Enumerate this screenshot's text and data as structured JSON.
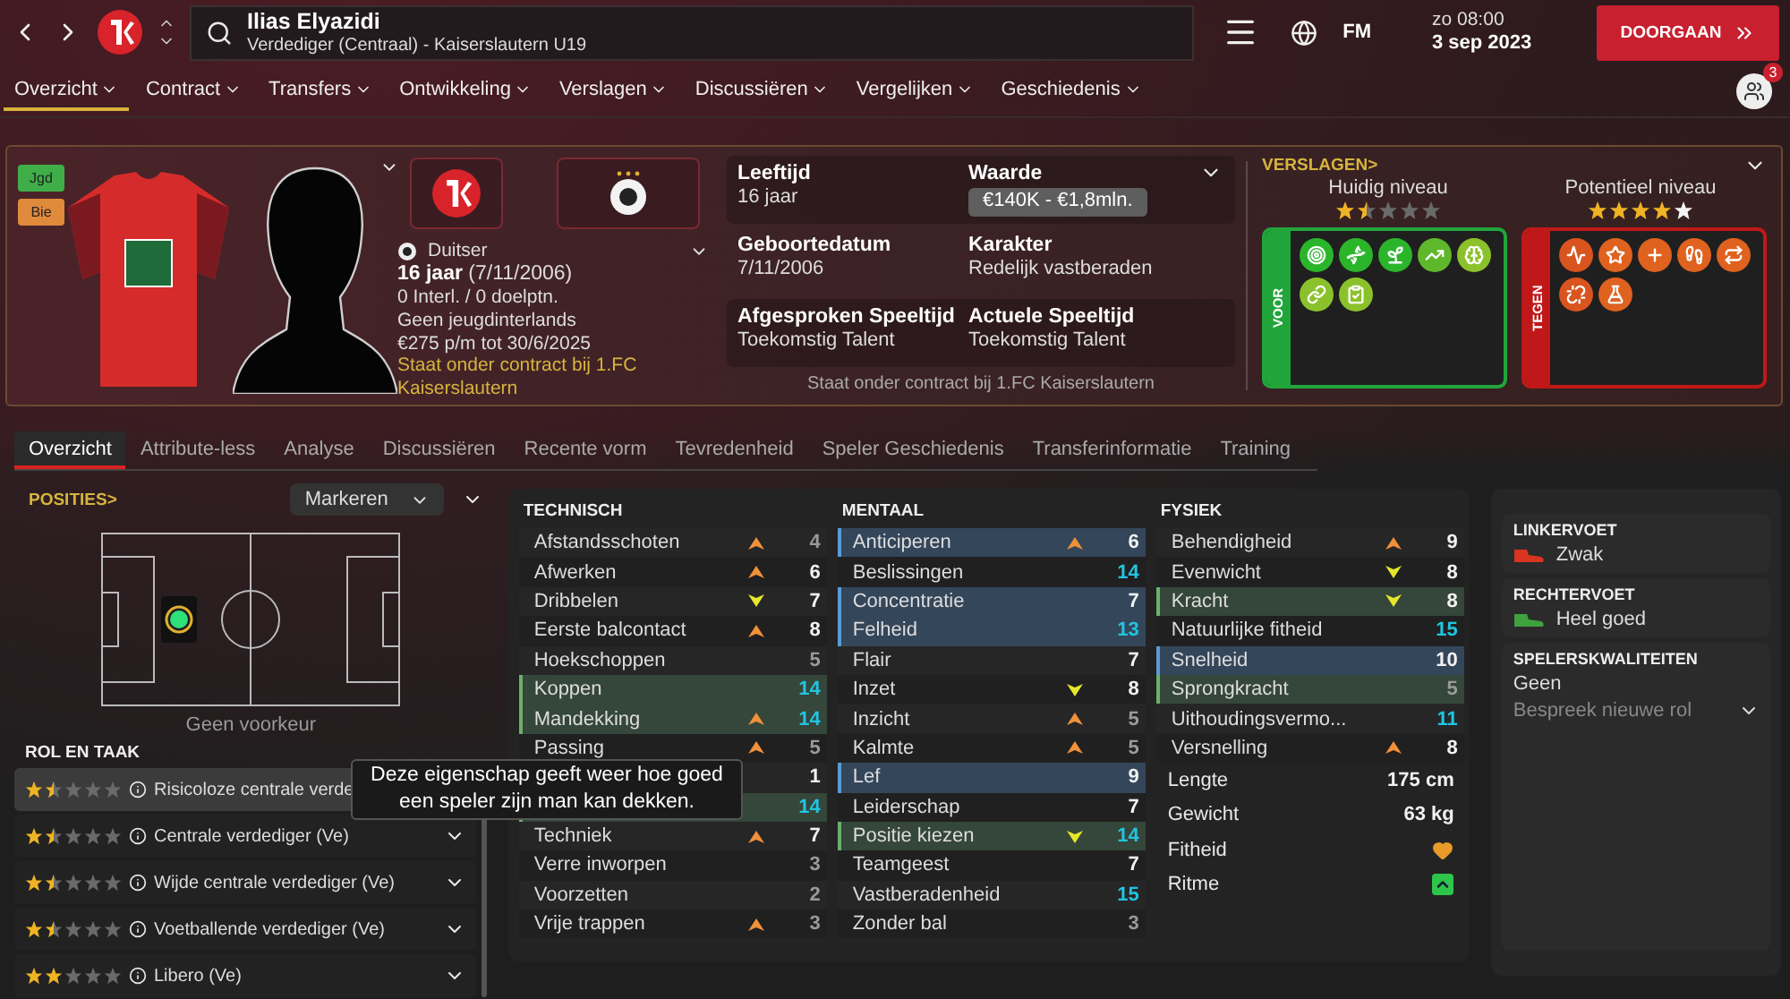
{
  "topbar": {
    "title": "Ilias Elyazidi",
    "subtitle": "Verdediger (Centraal) - Kaiserslautern U19",
    "logo_text": "FM",
    "day_time": "zo 08:00",
    "date": "3 sep 2023",
    "continue_button": "DOORGAAN"
  },
  "nav": {
    "items": [
      {
        "label": "Overzicht",
        "selected": true
      },
      {
        "label": "Contract",
        "selected": false
      },
      {
        "label": "Transfers",
        "selected": false
      },
      {
        "label": "Ontwikkeling",
        "selected": false
      },
      {
        "label": "Verslagen",
        "selected": false
      },
      {
        "label": "Discussiëren",
        "selected": false
      },
      {
        "label": "Vergelijken",
        "selected": false
      },
      {
        "label": "Geschiedenis",
        "selected": false
      }
    ],
    "badge": "3"
  },
  "profile": {
    "tags": [
      {
        "label": "Jgd",
        "color": "#3fae49"
      },
      {
        "label": "Bie",
        "color": "#e08a3c"
      }
    ],
    "nationality": "Duitser",
    "age_line": "**16 jaar** (7/11/2006)",
    "caps": "0 Interl. / 0 doelptn.",
    "youth_caps": "Geen jeugdinterlands",
    "wage": "€275 p/m tot 30/6/2025",
    "contract_status": "Staat onder contract bij 1.FC Kaiserslautern"
  },
  "facts": {
    "items": [
      {
        "label": "Leeftijd",
        "value": "16 jaar",
        "kind": "text"
      },
      {
        "label": "Waarde",
        "value": "€140K - €1,8mln.",
        "kind": "pill"
      },
      {
        "label": "Geboortedatum",
        "value": "7/11/2006",
        "kind": "text"
      },
      {
        "label": "Karakter",
        "value": "Redelijk vastberaden",
        "kind": "text"
      },
      {
        "label": "Afgesproken Speeltijd",
        "value": "Toekomstig Talent",
        "kind": "text"
      },
      {
        "label": "Actuele Speeltijd",
        "value": "Toekomstig Talent",
        "kind": "text"
      }
    ],
    "footer": "Staat onder contract bij 1.FC Kaiserslautern"
  },
  "reports": {
    "link": "VERSLAGEN>",
    "levels": [
      {
        "label": "Huidig niveau",
        "stars": 1.5,
        "range": false
      },
      {
        "label": "Potentieel niveau",
        "stars": 4,
        "range": true
      }
    ],
    "pro_label": "VOOR",
    "pros": [
      {
        "kind": "target"
      },
      {
        "kind": "dna"
      },
      {
        "kind": "sprout"
      },
      {
        "kind": "trend"
      },
      {
        "kind": "brain"
      },
      {
        "kind": "link"
      },
      {
        "kind": "clipboard"
      }
    ],
    "con_label": "TEGEN",
    "cons": [
      {
        "kind": "pulse"
      },
      {
        "kind": "star"
      },
      {
        "kind": "plus"
      },
      {
        "kind": "foot"
      },
      {
        "kind": "repeat"
      },
      {
        "kind": "unlink"
      },
      {
        "kind": "flask"
      }
    ]
  },
  "tabs": [
    {
      "label": "Overzicht",
      "selected": true
    },
    {
      "label": "Attribute-less",
      "selected": false
    },
    {
      "label": "Analyse",
      "selected": false
    },
    {
      "label": "Discussiëren",
      "selected": false
    },
    {
      "label": "Recente vorm",
      "selected": false
    },
    {
      "label": "Tevredenheid",
      "selected": false
    },
    {
      "label": "Speler Geschiedenis",
      "selected": false
    },
    {
      "label": "Transferinformatie",
      "selected": false
    },
    {
      "label": "Training",
      "selected": false
    }
  ],
  "positions": {
    "link": "POSITIES>",
    "view": "Markeren",
    "preference": "Geen voorkeur"
  },
  "roles": {
    "title": "ROL EN TAAK",
    "items": [
      {
        "name": "Risicoloze centrale verde",
        "stars": 1.5,
        "selected": true
      },
      {
        "name": "Centrale verdediger (Ve)",
        "stars": 1.5,
        "selected": false
      },
      {
        "name": "Wijde centrale verdediger (Ve)",
        "stars": 1.5,
        "selected": false
      },
      {
        "name": "Voetballende verdediger (Ve)",
        "stars": 1.5,
        "selected": false
      },
      {
        "name": "Libero (Ve)",
        "stars": 2,
        "selected": false
      }
    ]
  },
  "attributes": {
    "groups": [
      {
        "title": "TECHNISCH",
        "rows": [
          {
            "name": "Afstandsschoten",
            "value": "4",
            "rising": true,
            "falling": false,
            "strong": false,
            "weak": true,
            "key": false,
            "preferred": false
          },
          {
            "name": "Afwerken",
            "value": "6",
            "rising": true,
            "falling": false,
            "strong": false,
            "weak": false,
            "key": false,
            "preferred": false
          },
          {
            "name": "Dribbelen",
            "value": "7",
            "rising": false,
            "falling": true,
            "strong": false,
            "weak": false,
            "key": false,
            "preferred": false
          },
          {
            "name": "Eerste balcontact",
            "value": "8",
            "rising": true,
            "falling": false,
            "strong": false,
            "weak": false,
            "key": false,
            "preferred": false
          },
          {
            "name": "Hoekschoppen",
            "value": "5",
            "rising": false,
            "falling": false,
            "strong": false,
            "weak": true,
            "key": false,
            "preferred": false
          },
          {
            "name": "Koppen",
            "value": "14",
            "rising": false,
            "falling": false,
            "strong": true,
            "weak": false,
            "key": false,
            "preferred": true
          },
          {
            "name": "Mandekking",
            "value": "14",
            "rising": true,
            "falling": false,
            "strong": true,
            "weak": false,
            "key": false,
            "preferred": true
          },
          {
            "name": "Passing",
            "value": "5",
            "rising": true,
            "falling": false,
            "strong": false,
            "weak": true,
            "key": false,
            "preferred": false
          },
          {
            "value": "1",
            "rising": false,
            "falling": false,
            "strong": false,
            "weak": false,
            "key": false,
            "preferred": false
          },
          {
            "value": "14",
            "rising": false,
            "falling": false,
            "strong": true,
            "weak": false,
            "key": false,
            "preferred": true
          },
          {
            "name": "Techniek",
            "value": "7",
            "rising": true,
            "falling": false,
            "strong": false,
            "weak": false,
            "key": false,
            "preferred": false
          },
          {
            "name": "Verre inworpen",
            "value": "3",
            "rising": false,
            "falling": false,
            "strong": false,
            "weak": true,
            "key": false,
            "preferred": false
          },
          {
            "name": "Voorzetten",
            "value": "2",
            "rising": false,
            "falling": false,
            "strong": false,
            "weak": true,
            "key": false,
            "preferred": false
          },
          {
            "name": "Vrije trappen",
            "value": "3",
            "rising": true,
            "falling": false,
            "strong": false,
            "weak": true,
            "key": false,
            "preferred": false
          }
        ]
      },
      {
        "title": "MENTAAL",
        "rows": [
          {
            "name": "Anticiperen",
            "value": "6",
            "rising": true,
            "falling": false,
            "strong": false,
            "weak": false,
            "key": true,
            "preferred": false
          },
          {
            "name": "Beslissingen",
            "value": "14",
            "rising": false,
            "falling": false,
            "strong": true,
            "weak": false,
            "key": false,
            "preferred": false
          },
          {
            "name": "Concentratie",
            "value": "7",
            "rising": false,
            "falling": false,
            "strong": false,
            "weak": false,
            "key": true,
            "preferred": false
          },
          {
            "name": "Felheid",
            "value": "13",
            "rising": false,
            "falling": false,
            "strong": true,
            "weak": false,
            "key": true,
            "preferred": false
          },
          {
            "name": "Flair",
            "value": "7",
            "rising": false,
            "falling": false,
            "strong": false,
            "weak": false,
            "key": false,
            "preferred": false
          },
          {
            "name": "Inzet",
            "value": "8",
            "rising": false,
            "falling": true,
            "strong": false,
            "weak": false,
            "key": false,
            "preferred": false
          },
          {
            "name": "Inzicht",
            "value": "5",
            "rising": true,
            "falling": false,
            "strong": false,
            "weak": true,
            "key": false,
            "preferred": false
          },
          {
            "name": "Kalmte",
            "value": "5",
            "rising": true,
            "falling": false,
            "strong": false,
            "weak": true,
            "key": false,
            "preferred": false
          },
          {
            "name": "Lef",
            "value": "9",
            "rising": false,
            "falling": false,
            "strong": false,
            "weak": false,
            "key": true,
            "preferred": false
          },
          {
            "name": "Leiderschap",
            "value": "7",
            "rising": false,
            "falling": false,
            "strong": false,
            "weak": false,
            "key": false,
            "preferred": false
          },
          {
            "name": "Positie kiezen",
            "value": "14",
            "rising": false,
            "falling": true,
            "strong": true,
            "weak": false,
            "key": false,
            "preferred": true
          },
          {
            "name": "Teamgeest",
            "value": "7",
            "rising": false,
            "falling": false,
            "strong": false,
            "weak": false,
            "key": false,
            "preferred": false
          },
          {
            "name": "Vastberadenheid",
            "value": "15",
            "rising": false,
            "falling": false,
            "strong": true,
            "weak": false,
            "key": false,
            "preferred": false
          },
          {
            "name": "Zonder bal",
            "value": "3",
            "rising": false,
            "falling": false,
            "strong": false,
            "weak": true,
            "key": false,
            "preferred": false
          }
        ]
      },
      {
        "title": "FYSIEK",
        "rows": [
          {
            "name": "Behendigheid",
            "value": "9",
            "rising": true,
            "falling": false,
            "strong": false,
            "weak": false,
            "key": false,
            "preferred": false
          },
          {
            "name": "Evenwicht",
            "value": "8",
            "rising": false,
            "falling": true,
            "strong": false,
            "weak": false,
            "key": false,
            "preferred": false
          },
          {
            "name": "Kracht",
            "value": "8",
            "rising": false,
            "falling": true,
            "strong": false,
            "weak": false,
            "key": false,
            "preferred": true
          },
          {
            "name": "Natuurlijke fitheid",
            "value": "15",
            "rising": false,
            "falling": false,
            "strong": true,
            "weak": false,
            "key": false,
            "preferred": false
          },
          {
            "name": "Snelheid",
            "value": "10",
            "rising": false,
            "falling": false,
            "strong": false,
            "weak": false,
            "key": true,
            "preferred": false
          },
          {
            "name": "Sprongkracht",
            "value": "5",
            "rising": false,
            "falling": false,
            "strong": false,
            "weak": true,
            "key": false,
            "preferred": true
          },
          {
            "name": "Uithoudingsvermo...",
            "value": "11",
            "rising": false,
            "falling": false,
            "strong": true,
            "weak": false,
            "key": false,
            "preferred": false
          },
          {
            "name": "Versnelling",
            "value": "8",
            "rising": true,
            "falling": false,
            "strong": false,
            "weak": false,
            "key": false,
            "preferred": false
          }
        ]
      }
    ],
    "extras": [
      {
        "label": "Lengte",
        "kind": "text",
        "value": "175 cm"
      },
      {
        "label": "Gewicht",
        "kind": "text",
        "value": "63 kg"
      },
      {
        "label": "Fitheid",
        "kind": "heart"
      },
      {
        "label": "Ritme",
        "kind": "rising"
      }
    ]
  },
  "tooltip": "Deze eigenschap geeft weer hoe goed een speler zijn man kan dekken.",
  "side": {
    "feet": [
      {
        "label": "LINKERVOET",
        "value": "Zwak",
        "color": "#d9341f"
      },
      {
        "label": "RECHTERVOET",
        "value": "Heel goed",
        "color": "#3fa23f"
      }
    ],
    "qualities_title": "SPELERSKWALITEITEN",
    "qualities": "Geen",
    "role_select": "Bespreek nieuwe rol"
  }
}
